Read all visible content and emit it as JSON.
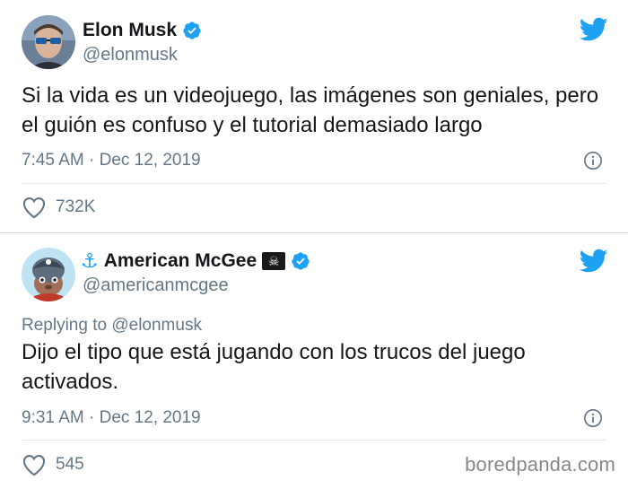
{
  "tweets": [
    {
      "author_name": "Elon Musk",
      "author_handle": "@elonmusk",
      "text": "Si la vida es un videojuego, las imágenes son geniales, pero el guión es confuso y el tutorial demasiado largo",
      "meta": "7:45 AM · Dec 12, 2019",
      "likes": "732K"
    },
    {
      "author_name": "American McGee",
      "author_handle": "@americanmcgee",
      "reply_prefix": "Replying to",
      "reply_mention": "@elonmusk",
      "text": "Dijo el tipo que está jugando con los trucos del juego activados.",
      "meta": "9:31 AM · Dec 12, 2019",
      "likes": "545"
    }
  ],
  "watermark": "boredpanda.com",
  "icons": {
    "verified": "verified-badge-icon",
    "brand": "twitter-bird-icon",
    "info": "info-icon",
    "like": "heart-icon",
    "anchor": "anchor-emoji-icon",
    "flag": "pirate-flag-emoji-icon"
  },
  "colors": {
    "twitter_blue": "#1da1f2",
    "text_primary": "#14171a",
    "text_secondary": "#657786",
    "divider": "#e1e8ed"
  }
}
